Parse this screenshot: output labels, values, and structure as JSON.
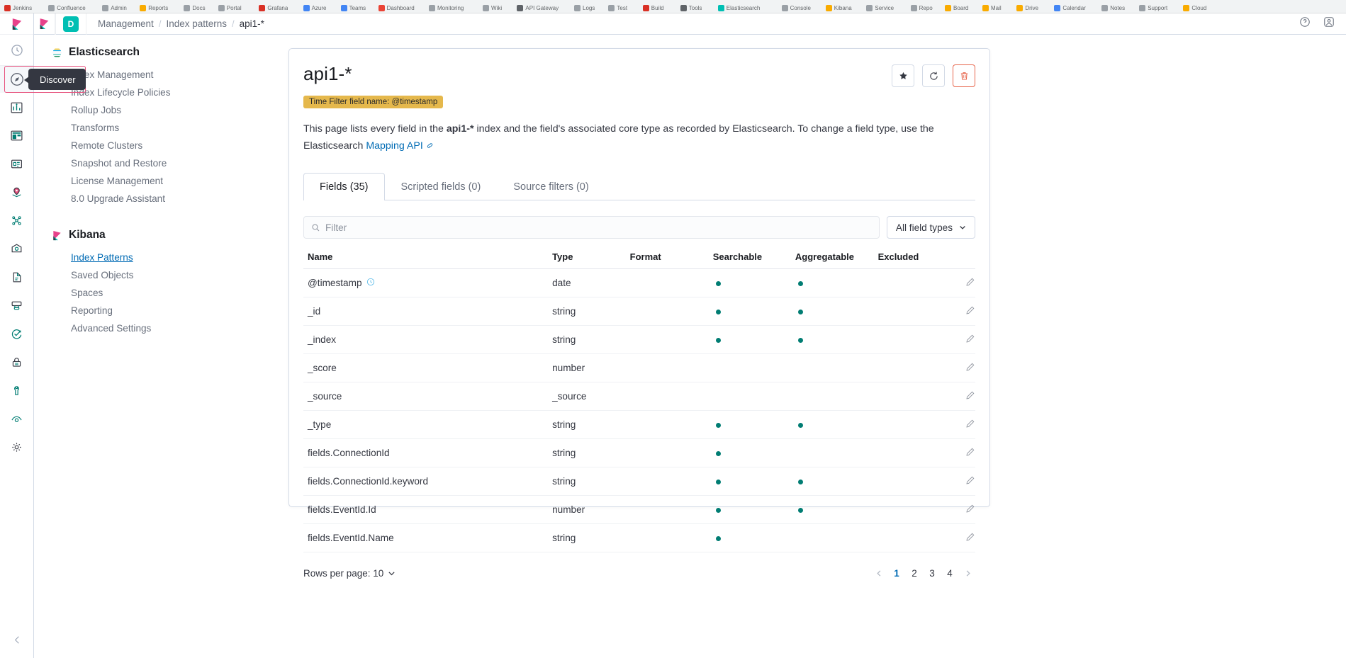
{
  "browser": {
    "bookmarks": [
      {
        "label": "Jenkins",
        "color": "#d93025"
      },
      {
        "label": "Confluence",
        "color": "#9aa0a6"
      },
      {
        "label": "Admin",
        "color": "#9aa0a6"
      },
      {
        "label": "Reports",
        "color": "#f9ab00"
      },
      {
        "label": "Docs",
        "color": "#9aa0a6"
      },
      {
        "label": "Portal",
        "color": "#9aa0a6"
      },
      {
        "label": "Grafana",
        "color": "#d93025"
      },
      {
        "label": "Azure",
        "color": "#4285f4"
      },
      {
        "label": "Teams",
        "color": "#4285f4"
      },
      {
        "label": "Dashboard",
        "color": "#ea4335"
      },
      {
        "label": "Monitoring",
        "color": "#9aa0a6"
      },
      {
        "label": "Wiki",
        "color": "#9aa0a6"
      },
      {
        "label": "API Gateway",
        "color": "#5f6368"
      },
      {
        "label": "Logs",
        "color": "#9aa0a6"
      },
      {
        "label": "Test",
        "color": "#9aa0a6"
      },
      {
        "label": "Build",
        "color": "#d93025"
      },
      {
        "label": "Tools",
        "color": "#5f6368"
      },
      {
        "label": "Elasticsearch",
        "color": "#00bfb3"
      },
      {
        "label": "Console",
        "color": "#9aa0a6"
      },
      {
        "label": "Kibana",
        "color": "#f9ab00"
      },
      {
        "label": "Service",
        "color": "#9aa0a6"
      },
      {
        "label": "Repo",
        "color": "#9aa0a6"
      },
      {
        "label": "Board",
        "color": "#f9ab00"
      },
      {
        "label": "Mail",
        "color": "#f9ab00"
      },
      {
        "label": "Drive",
        "color": "#f9ab00"
      },
      {
        "label": "Calendar",
        "color": "#4285f4"
      },
      {
        "label": "Notes",
        "color": "#9aa0a6"
      },
      {
        "label": "Support",
        "color": "#9aa0a6"
      },
      {
        "label": "Cloud",
        "color": "#f9ab00"
      }
    ]
  },
  "topbar": {
    "space_initial": "D",
    "breadcrumbs": [
      {
        "label": "Management"
      },
      {
        "label": "Index patterns"
      },
      {
        "label": "api1-*"
      }
    ],
    "separator": "/",
    "right_icons": [
      "help-icon",
      "user-avatar-icon"
    ]
  },
  "rail": {
    "items": [
      {
        "name": "recently-viewed-icon",
        "selected": false
      },
      {
        "name": "discover-icon",
        "selected": true
      },
      {
        "name": "visualize-icon",
        "selected": false
      },
      {
        "name": "dashboard-icon",
        "selected": false
      },
      {
        "name": "canvas-icon",
        "selected": false
      },
      {
        "name": "maps-icon",
        "selected": false
      },
      {
        "name": "machine-learning-icon",
        "selected": false
      },
      {
        "name": "infrastructure-icon",
        "selected": false
      },
      {
        "name": "logs-icon",
        "selected": false
      },
      {
        "name": "apm-icon",
        "selected": false
      },
      {
        "name": "uptime-icon",
        "selected": false
      },
      {
        "name": "siem-icon",
        "selected": false
      },
      {
        "name": "dev-tools-icon",
        "selected": false
      },
      {
        "name": "monitoring-icon",
        "selected": false
      },
      {
        "name": "management-icon",
        "selected": false
      }
    ],
    "tooltip": "Discover"
  },
  "sidenav": {
    "groups": [
      {
        "title": "Elasticsearch",
        "icon": "elasticsearch-logo",
        "items": [
          {
            "label": "Index Management",
            "active": false
          },
          {
            "label": "Index Lifecycle Policies",
            "active": false
          },
          {
            "label": "Rollup Jobs",
            "active": false
          },
          {
            "label": "Transforms",
            "active": false
          },
          {
            "label": "Remote Clusters",
            "active": false
          },
          {
            "label": "Snapshot and Restore",
            "active": false
          },
          {
            "label": "License Management",
            "active": false
          },
          {
            "label": "8.0 Upgrade Assistant",
            "active": false
          }
        ]
      },
      {
        "title": "Kibana",
        "icon": "kibana-logo",
        "items": [
          {
            "label": "Index Patterns",
            "active": true
          },
          {
            "label": "Saved Objects",
            "active": false
          },
          {
            "label": "Spaces",
            "active": false
          },
          {
            "label": "Reporting",
            "active": false
          },
          {
            "label": "Advanced Settings",
            "active": false
          }
        ]
      }
    ]
  },
  "panel": {
    "title": "api1-*",
    "time_badge": "Time Filter field name: @timestamp",
    "description_prefix": "This page lists every field in the ",
    "description_bold": "api1-*",
    "description_mid": " index and the field's associated core type as recorded by Elasticsearch. To change a field type, use the Elasticsearch ",
    "description_link": "Mapping API",
    "actions": [
      {
        "name": "set-default-index-button",
        "icon": "star-icon"
      },
      {
        "name": "refresh-fields-button",
        "icon": "refresh-icon"
      },
      {
        "name": "delete-index-pattern-button",
        "icon": "trash-icon"
      }
    ],
    "tabs": [
      {
        "label": "Fields (35)",
        "active": true
      },
      {
        "label": "Scripted fields (0)",
        "active": false
      },
      {
        "label": "Source filters (0)",
        "active": false
      }
    ],
    "filter": {
      "placeholder": "Filter",
      "value": ""
    },
    "field_types_button": "All field types"
  },
  "table": {
    "columns": [
      "Name",
      "Type",
      "Format",
      "Searchable",
      "Aggregatable",
      "Excluded"
    ],
    "rows": [
      {
        "name": "@timestamp",
        "clock": true,
        "type": "date",
        "format": "",
        "searchable": true,
        "aggregatable": true,
        "excluded": false
      },
      {
        "name": "_id",
        "clock": false,
        "type": "string",
        "format": "",
        "searchable": true,
        "aggregatable": true,
        "excluded": false
      },
      {
        "name": "_index",
        "clock": false,
        "type": "string",
        "format": "",
        "searchable": true,
        "aggregatable": true,
        "excluded": false
      },
      {
        "name": "_score",
        "clock": false,
        "type": "number",
        "format": "",
        "searchable": false,
        "aggregatable": false,
        "excluded": false
      },
      {
        "name": "_source",
        "clock": false,
        "type": "_source",
        "format": "",
        "searchable": false,
        "aggregatable": false,
        "excluded": false
      },
      {
        "name": "_type",
        "clock": false,
        "type": "string",
        "format": "",
        "searchable": true,
        "aggregatable": true,
        "excluded": false
      },
      {
        "name": "fields.ConnectionId",
        "clock": false,
        "type": "string",
        "format": "",
        "searchable": true,
        "aggregatable": false,
        "excluded": false
      },
      {
        "name": "fields.ConnectionId.keyword",
        "clock": false,
        "type": "string",
        "format": "",
        "searchable": true,
        "aggregatable": true,
        "excluded": false
      },
      {
        "name": "fields.EventId.Id",
        "clock": false,
        "type": "number",
        "format": "",
        "searchable": true,
        "aggregatable": true,
        "excluded": false
      },
      {
        "name": "fields.EventId.Name",
        "clock": false,
        "type": "string",
        "format": "",
        "searchable": true,
        "aggregatable": false,
        "excluded": false
      }
    ]
  },
  "pagination": {
    "rows_per_page_label": "Rows per page: 10",
    "pages": [
      "1",
      "2",
      "3",
      "4"
    ],
    "current": "1"
  }
}
